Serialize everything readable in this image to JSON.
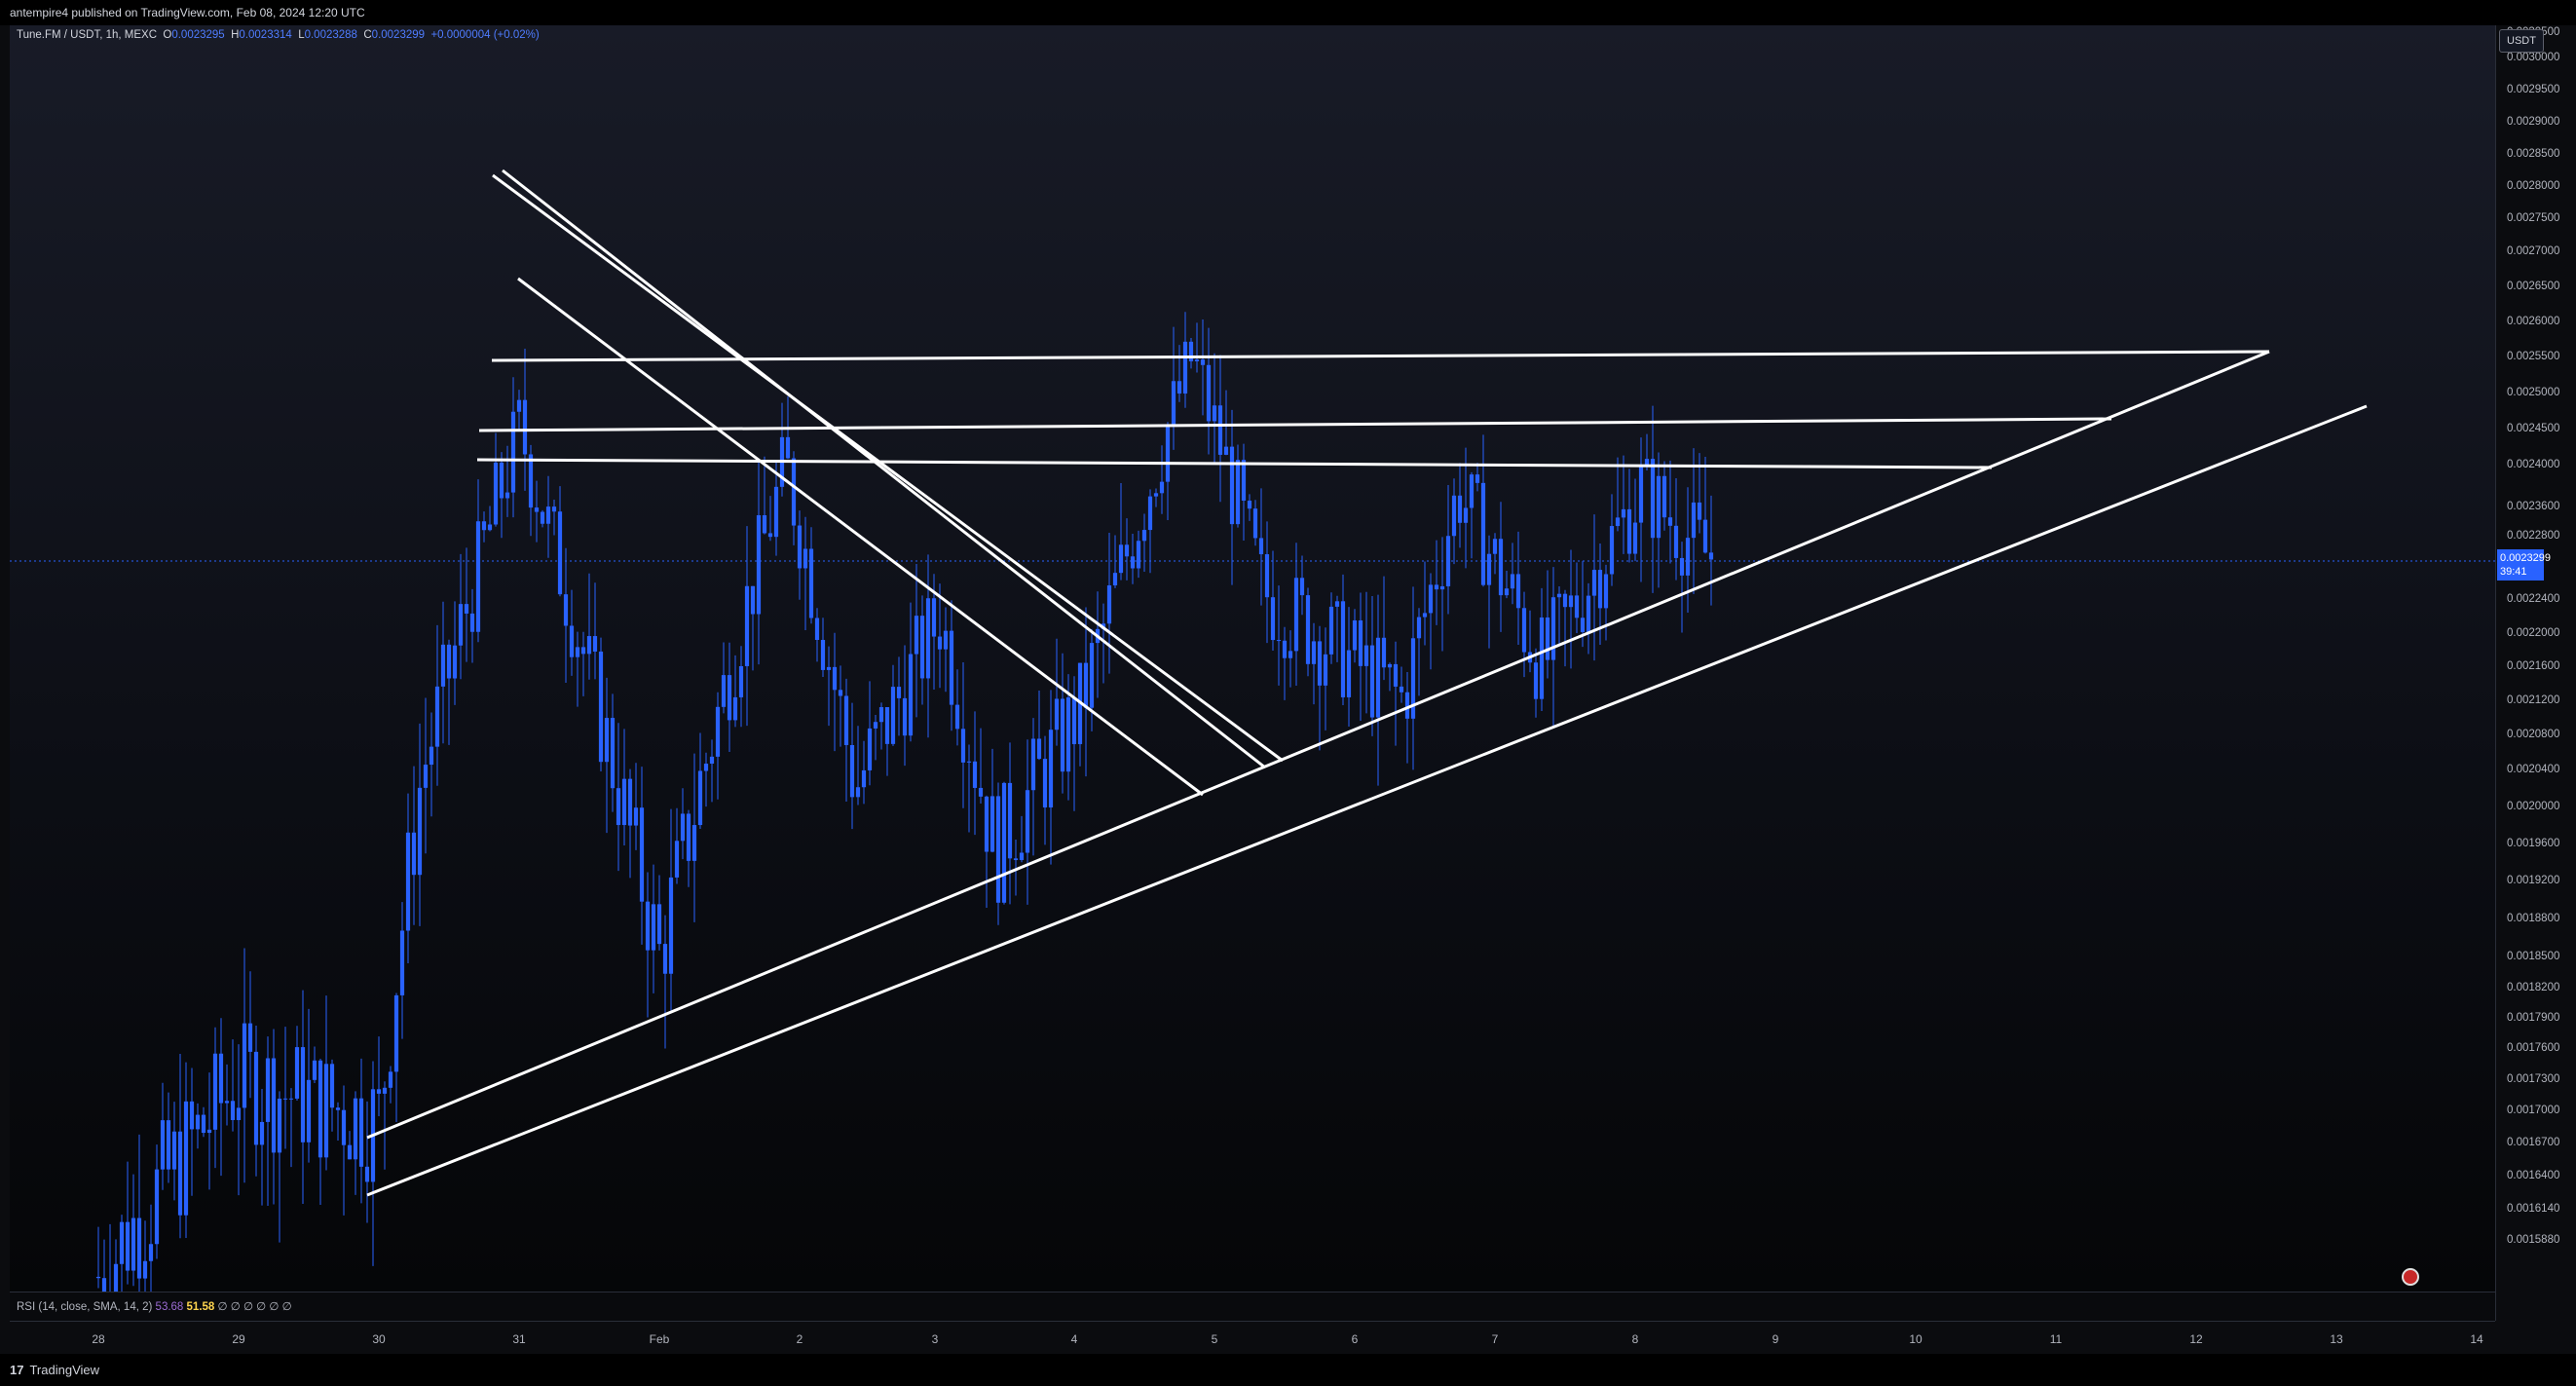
{
  "header": {
    "publisher_line": "antempire4 published on TradingView.com, Feb 08, 2024 12:20 UTC"
  },
  "legend": {
    "symbol": "Tune.FM / USDT, 1h, MEXC",
    "o_label": "O",
    "o_value": "0.0023295",
    "h_label": "H",
    "h_value": "0.0023314",
    "l_label": "L",
    "l_value": "0.0023288",
    "c_label": "C",
    "c_value": "0.0023299",
    "change": "+0.0000004 (+0.02%)"
  },
  "price_axis": {
    "currency": "USDT",
    "ticks": [
      "0.0030500",
      "0.0030000",
      "0.0029500",
      "0.0029000",
      "0.0028500",
      "0.0028000",
      "0.0027500",
      "0.0027000",
      "0.0026500",
      "0.0026000",
      "0.0025500",
      "0.0025000",
      "0.0024500",
      "0.0024000",
      "0.0023600",
      "0.0022800",
      "0.0022400",
      "0.0022000",
      "0.0021600",
      "0.0021200",
      "0.0020800",
      "0.0020400",
      "0.0020000",
      "0.0019600",
      "0.0019200",
      "0.0018800",
      "0.0018500",
      "0.0018200",
      "0.0017900",
      "0.0017600",
      "0.0017300",
      "0.0017000",
      "0.0016700",
      "0.0016400",
      "0.0016140",
      "0.0015880"
    ],
    "last_price": "0.0023299",
    "countdown": "39:41"
  },
  "time_axis": {
    "ticks": [
      "28",
      "29",
      "30",
      "31",
      "Feb",
      "2",
      "3",
      "4",
      "5",
      "6",
      "7",
      "8",
      "9",
      "10",
      "11",
      "12",
      "13",
      "14"
    ]
  },
  "rsi": {
    "label": "RSI (14, close, SMA, 14, 2)",
    "rsi_value": "53.68",
    "sma_value": "51.58",
    "extra": "∅ ∅ ∅ ∅ ∅ ∅"
  },
  "footer": {
    "brand": "TradingView",
    "logo": "17"
  },
  "colors": {
    "candle": "#2962ff",
    "drawing": "#ffffff",
    "background": "#0b0c0f"
  },
  "chart_data": {
    "type": "candlestick",
    "title": "Tune.FM / USDT, 1h, MEXC",
    "ylim": [
      0.00158,
      0.00305
    ],
    "key_points": [
      {
        "x": "Jan 28",
        "close": 0.00158
      },
      {
        "x": "Jan 29",
        "close": 0.00176
      },
      {
        "x": "Jan 30",
        "close": 0.00172
      },
      {
        "x": "Jan 30 late",
        "close": 0.00207
      },
      {
        "x": "Jan 31",
        "close": 0.0025
      },
      {
        "x": "Feb 1",
        "close": 0.00188
      },
      {
        "x": "Feb 2",
        "close": 0.00245
      },
      {
        "x": "Feb 2 late",
        "close": 0.00206
      },
      {
        "x": "Feb 3",
        "close": 0.00226
      },
      {
        "x": "Feb 3 late",
        "close": 0.00199
      },
      {
        "x": "Feb 4",
        "close": 0.00215
      },
      {
        "x": "Feb 5",
        "close": 0.0026
      },
      {
        "x": "Feb 5 late",
        "close": 0.00229
      },
      {
        "x": "Feb 6",
        "close": 0.00216
      },
      {
        "x": "Feb 6 late",
        "close": 0.00242
      },
      {
        "x": "Feb 7",
        "close": 0.0022
      },
      {
        "x": "Feb 8",
        "close": 0.00242
      },
      {
        "x": "Feb 8 late",
        "close": 0.00233
      }
    ],
    "last_close": 0.0023299
  }
}
